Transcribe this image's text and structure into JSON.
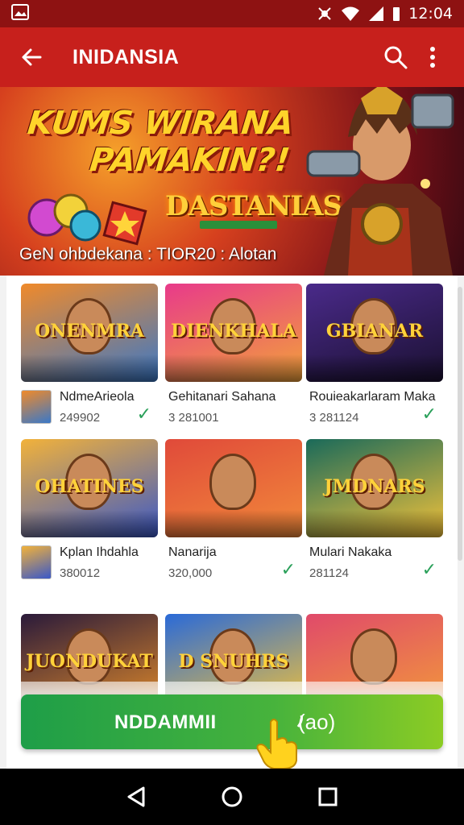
{
  "status_bar": {
    "time": "12:04",
    "icons": [
      "gallery-icon",
      "network-activity-icon",
      "wifi-icon",
      "signal-icon",
      "battery-icon"
    ]
  },
  "app_bar": {
    "title": "INIDANSIA",
    "icons": [
      "back-arrow-icon",
      "search-icon",
      "more-vert-icon"
    ]
  },
  "banner": {
    "headline_line1": "KUMS WIRANA",
    "headline_line2": "PAMAKIN?!",
    "game_logo": "DASTANIAS",
    "caption": "GeN ohbdekana : TIOR20 : Alotan"
  },
  "games": [
    {
      "thumb_title": "ONENMRA",
      "name": "NdmeArieola",
      "count": "249902",
      "installed": true,
      "colors": [
        "#f08a2a",
        "#3a78c8"
      ]
    },
    {
      "thumb_title": "DIENKHALA",
      "name": "Gehitanari Sahana",
      "count": "3 281001",
      "installed": false,
      "colors": [
        "#e83a8a",
        "#f2a23a"
      ]
    },
    {
      "thumb_title": "GBIANAR",
      "name": "Rouieakarlaram Maka",
      "count": "3 281124",
      "installed": true,
      "colors": [
        "#4a2a8a",
        "#1a1030"
      ]
    },
    {
      "thumb_title": "OHATINES",
      "name": "Kplan Ihdahla",
      "count": "380012",
      "installed": false,
      "colors": [
        "#f2b23a",
        "#3a58c8"
      ]
    },
    {
      "thumb_title": "",
      "name": "Nanarija",
      "count": "320,000",
      "installed": true,
      "colors": [
        "#e04a3a",
        "#f28a3a"
      ]
    },
    {
      "thumb_title": "JMDNARS",
      "name": "Mulari Nakaka",
      "count": "281124",
      "installed": true,
      "colors": [
        "#1a6a5a",
        "#f2c23a"
      ]
    },
    {
      "thumb_title": "JUONDUKAT",
      "name": "",
      "count": "",
      "installed": false,
      "colors": [
        "#2a1a3a",
        "#e08a2a"
      ]
    },
    {
      "thumb_title": "D SNUHRS",
      "name": "",
      "count": "",
      "installed": false,
      "colors": [
        "#2a6ad8",
        "#f2c23a"
      ]
    },
    {
      "thumb_title": "",
      "name": "",
      "count": "",
      "installed": false,
      "colors": [
        "#e04a6a",
        "#f29a3a"
      ]
    }
  ],
  "install_button": {
    "label": "NDDAMMII",
    "suffix": "(ao)"
  },
  "nav_bar": {
    "icons": [
      "back-triangle-icon",
      "home-circle-icon",
      "recents-square-icon"
    ]
  },
  "colors": {
    "status_bar": "#8e1212",
    "app_bar": "#c7201c",
    "check": "#2aa05a",
    "cta_start": "#1e9e48",
    "cta_end": "#8ccc24"
  }
}
